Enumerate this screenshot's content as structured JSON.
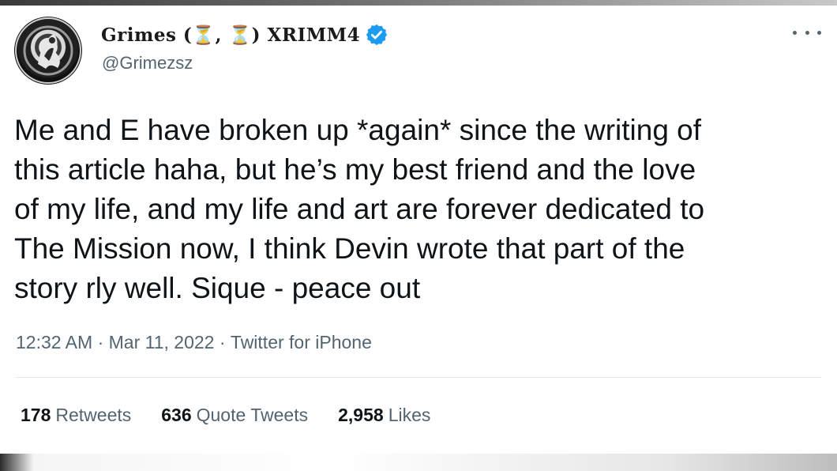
{
  "user": {
    "display_name": "Grimes (⏳, ⏳) XRIMM4",
    "handle": "@Grimezsz",
    "verified": true
  },
  "tweet": {
    "text": "Me and E have broken up *again* since the writing of\nthis article haha, but he’s my best friend and the love\nof my life, and my life and art are forever dedicated to\nThe Mission now, I think Devin wrote that part of the\nstory rly well.   Sique - peace out"
  },
  "meta": {
    "time": "12:32 AM",
    "sep1": " · ",
    "date": "Mar 11, 2022",
    "sep2": " · ",
    "source": "Twitter for iPhone"
  },
  "stats": {
    "retweets_count": "178",
    "retweets_label": "Retweets",
    "quotes_count": "636",
    "quotes_label": "Quote Tweets",
    "likes_count": "2,958",
    "likes_label": "Likes"
  },
  "colors": {
    "text_primary": "#0f1419",
    "text_secondary": "#536471",
    "verified_blue": "#1d9bf0",
    "divider": "#e3e7ea"
  },
  "icons": {
    "more": "more-horizontal-icon",
    "verified": "verified-badge-icon"
  }
}
